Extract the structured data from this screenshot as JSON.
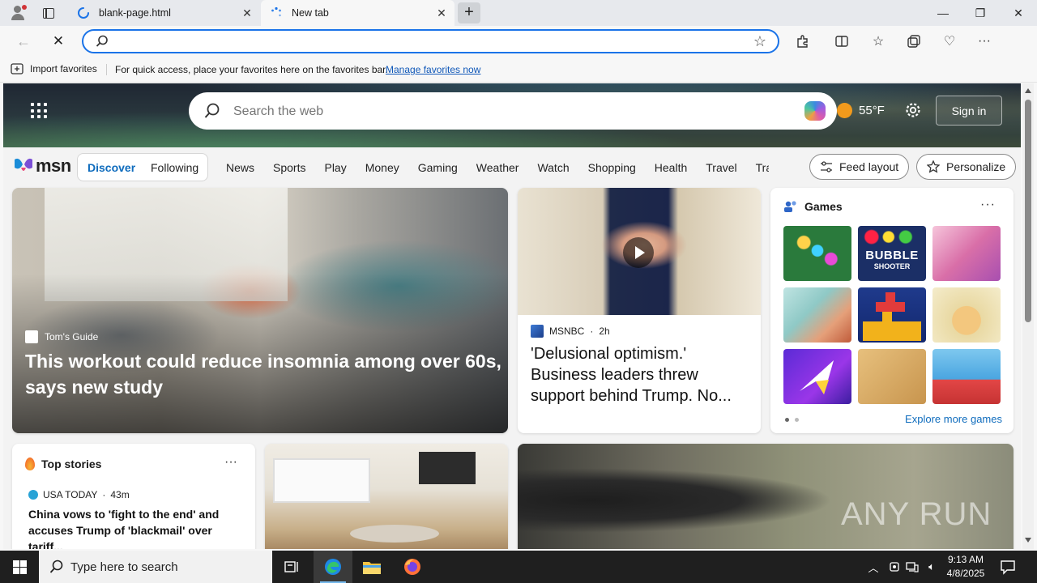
{
  "colors": {
    "accent": "#0f6cbd",
    "address_focus": "#1a73e8",
    "taskbar": "#1f1f1f",
    "tab_active": "#f7f7f7"
  },
  "browser": {
    "tabs": [
      {
        "label": "blank-page.html",
        "icon": "edge-loading-icon"
      },
      {
        "label": "New tab",
        "icon": "spinner-icon"
      }
    ],
    "address": {
      "value": "",
      "placeholder": ""
    },
    "favorites_bar": {
      "import_label": "Import favorites",
      "message": "For quick access, place your favorites here on the favorites bar.",
      "link": "Manage favorites now"
    }
  },
  "msn": {
    "search_placeholder": "Search the web",
    "weather": {
      "temp": "55",
      "unit": "°F"
    },
    "signin_label": "Sign in",
    "logo_text": "msn",
    "feed_tabs": [
      "Discover",
      "Following"
    ],
    "categories": [
      "News",
      "Sports",
      "Play",
      "Money",
      "Gaming",
      "Weather",
      "Watch",
      "Shopping",
      "Health",
      "Travel",
      "Tra"
    ],
    "feed_layout_label": "Feed layout",
    "personalize_label": "Personalize",
    "hero_article": {
      "source": "Tom's Guide",
      "title": "This workout could reduce insomnia among over 60s, says new study"
    },
    "video_article": {
      "source": "MSNBC",
      "age": "2h",
      "title": "'Delusional optimism.' Business leaders threw support behind Trump. No..."
    },
    "games": {
      "header": "Games",
      "bubble_text": "BUBBLE",
      "bubble_sub": "SHOOTER",
      "explore_label": "Explore more games"
    },
    "top_stories": {
      "header": "Top stories",
      "source": "USA TODAY",
      "age": "43m",
      "title": "China vows to 'fight to the end' and accuses Trump of 'blackmail' over tariff..."
    },
    "watermark": "ANY RUN"
  },
  "taskbar": {
    "search_placeholder": "Type here to search",
    "time": "9:13 AM",
    "date": "4/8/2025"
  }
}
